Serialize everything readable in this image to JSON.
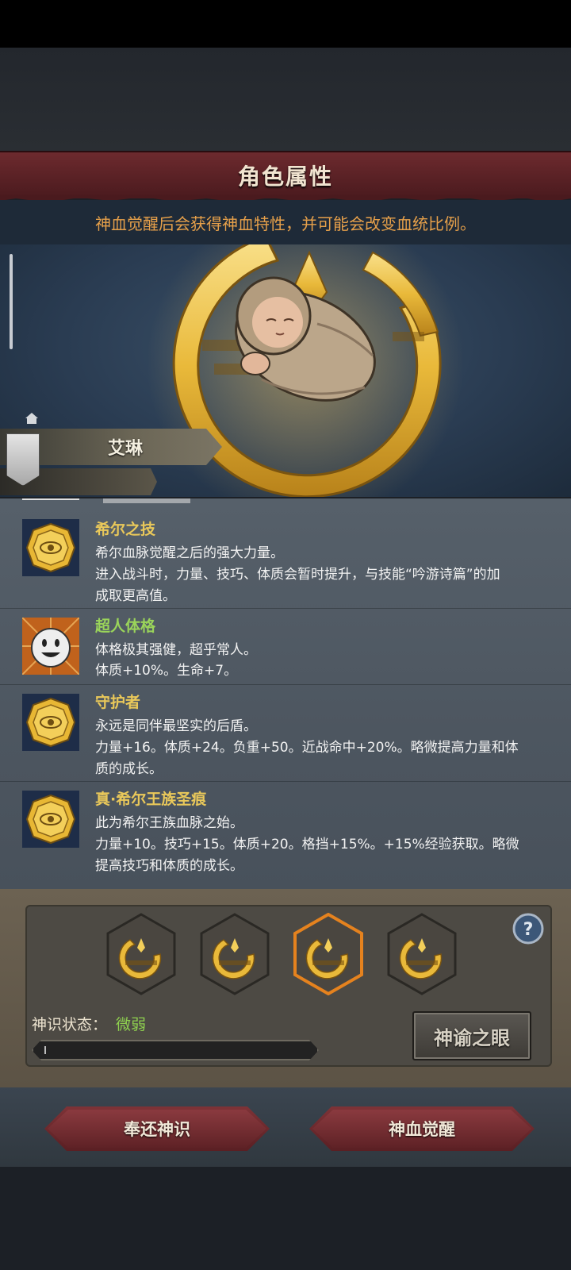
{
  "header": {
    "title": "角色属性"
  },
  "notice": "神血觉醒后会获得神血特性，并可能会改变血统比例。",
  "character": {
    "name": "艾琳"
  },
  "traits": [
    {
      "name": "希尔之技",
      "name_color": "gold",
      "icon": "gold-seal-icon",
      "lines": [
        "希尔血脉觉醒之后的强大力量。",
        "进入战斗时，力量、技巧、体质会暂时提升，与技能“吟游诗篇”的加",
        "成取更高值。"
      ]
    },
    {
      "name": "超人体格",
      "name_color": "green",
      "icon": "smiley-face-icon",
      "lines": [
        "体格极其强健，超乎常人。",
        "体质+10%。生命+7。"
      ]
    },
    {
      "name": "守护者",
      "name_color": "gold",
      "icon": "gold-seal-icon",
      "lines": [
        "永远是同伴最坚实的后盾。",
        "力量+16。体质+24。负重+50。近战命中+20%。略微提高力量和体",
        "质的成长。"
      ]
    },
    {
      "name": "真·希尔王族圣痕",
      "name_color": "gold",
      "icon": "gold-seal-icon",
      "lines": [
        "此为希尔王族血脉之始。",
        "力量+10。技巧+15。体质+20。格挡+15%。+15%经验获取。略微",
        "提高技巧和体质的成长。"
      ]
    }
  ],
  "divine_slots": [
    {
      "icon": "divine-crest-icon",
      "selected": false
    },
    {
      "icon": "divine-crest-icon",
      "selected": false
    },
    {
      "icon": "divine-crest-icon",
      "selected": true
    },
    {
      "icon": "divine-crest-icon",
      "selected": false
    }
  ],
  "divine_sense": {
    "label": "神识状态：",
    "value": "微弱",
    "progress": 0.0
  },
  "buttons": {
    "oracle": "神谕之眼",
    "return": "奉还神识",
    "awaken": "神血觉醒"
  },
  "colors": {
    "gold": "#e9c85a",
    "green": "#9ad45a",
    "banner": "#6d2a2e",
    "notice": "#e6a04a"
  }
}
